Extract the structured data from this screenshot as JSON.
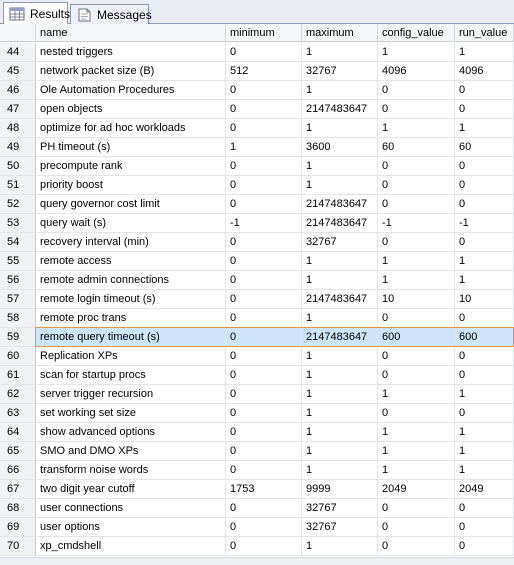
{
  "tabs": {
    "results": "Results",
    "messages": "Messages"
  },
  "columns": [
    "",
    "name",
    "minimum",
    "maximum",
    "config_value",
    "run_value"
  ],
  "selected_row": 59,
  "rows": [
    [
      "44",
      "nested triggers",
      "0",
      "1",
      "1",
      "1"
    ],
    [
      "45",
      "network packet size (B)",
      "512",
      "32767",
      "4096",
      "4096"
    ],
    [
      "46",
      "Ole Automation Procedures",
      "0",
      "1",
      "0",
      "0"
    ],
    [
      "47",
      "open objects",
      "0",
      "2147483647",
      "0",
      "0"
    ],
    [
      "48",
      "optimize for ad hoc workloads",
      "0",
      "1",
      "1",
      "1"
    ],
    [
      "49",
      "PH timeout (s)",
      "1",
      "3600",
      "60",
      "60"
    ],
    [
      "50",
      "precompute rank",
      "0",
      "1",
      "0",
      "0"
    ],
    [
      "51",
      "priority boost",
      "0",
      "1",
      "0",
      "0"
    ],
    [
      "52",
      "query governor cost limit",
      "0",
      "2147483647",
      "0",
      "0"
    ],
    [
      "53",
      "query wait (s)",
      "-1",
      "2147483647",
      "-1",
      "-1"
    ],
    [
      "54",
      "recovery interval (min)",
      "0",
      "32767",
      "0",
      "0"
    ],
    [
      "55",
      "remote access",
      "0",
      "1",
      "1",
      "1"
    ],
    [
      "56",
      "remote admin connections",
      "0",
      "1",
      "1",
      "1"
    ],
    [
      "57",
      "remote login timeout (s)",
      "0",
      "2147483647",
      "10",
      "10"
    ],
    [
      "58",
      "remote proc trans",
      "0",
      "1",
      "0",
      "0"
    ],
    [
      "59",
      "remote query timeout (s)",
      "0",
      "2147483647",
      "600",
      "600"
    ],
    [
      "60",
      "Replication XPs",
      "0",
      "1",
      "0",
      "0"
    ],
    [
      "61",
      "scan for startup procs",
      "0",
      "1",
      "0",
      "0"
    ],
    [
      "62",
      "server trigger recursion",
      "0",
      "1",
      "1",
      "1"
    ],
    [
      "63",
      "set working set size",
      "0",
      "1",
      "0",
      "0"
    ],
    [
      "64",
      "show advanced options",
      "0",
      "1",
      "1",
      "1"
    ],
    [
      "65",
      "SMO and DMO XPs",
      "0",
      "1",
      "1",
      "1"
    ],
    [
      "66",
      "transform noise words",
      "0",
      "1",
      "1",
      "1"
    ],
    [
      "67",
      "two digit year cutoff",
      "1753",
      "9999",
      "2049",
      "2049"
    ],
    [
      "68",
      "user connections",
      "0",
      "32767",
      "0",
      "0"
    ],
    [
      "69",
      "user options",
      "0",
      "32767",
      "0",
      "0"
    ],
    [
      "70",
      "xp_cmdshell",
      "0",
      "1",
      "0",
      "0"
    ]
  ]
}
